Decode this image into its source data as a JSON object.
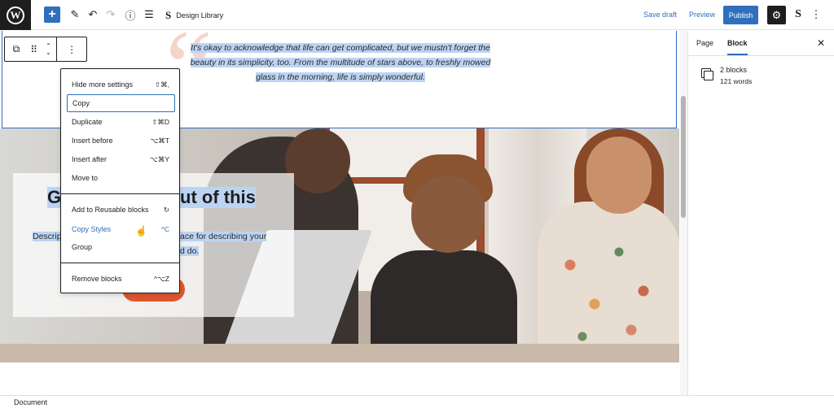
{
  "topbar": {
    "logo_letter": "W",
    "design_library_icon": "S",
    "design_library_label": "Design Library",
    "save_draft": "Save draft",
    "preview": "Preview",
    "publish": "Publish",
    "stackable_icon": "S",
    "icons": [
      "plus-icon",
      "pencil-icon",
      "undo-icon",
      "redo-icon",
      "info-icon",
      "list-view-icon",
      "gear-icon",
      "more-icon"
    ]
  },
  "canvas": {
    "quote_mark": "“",
    "quote_line1": "It's okay to acknowledge that life can get complicated, but we mustn't forget the",
    "quote_line2": "beauty in its simplicity, too. From the multitude of stars above, to freshly mowed",
    "quote_line3": "glass in the morning, life is simply wonderful.",
    "hero_title_left": "G",
    "hero_title_right": "ut of this",
    "hero_desc_left": "Descrip",
    "hero_desc_right": "ace for describing your",
    "hero_desc_line2": "d do."
  },
  "block_menu": {
    "items": [
      {
        "label": "Hide more settings",
        "shortcut": "⇧⌘,"
      },
      {
        "label": "Copy",
        "shortcut": ""
      },
      {
        "label": "Duplicate",
        "shortcut": "⇧⌘D"
      },
      {
        "label": "Insert before",
        "shortcut": "⌥⌘T"
      },
      {
        "label": "Insert after",
        "shortcut": "⌥⌘Y"
      },
      {
        "label": "Move to",
        "shortcut": ""
      },
      {
        "label": "Add to Reusable blocks",
        "shortcut": "↻"
      },
      {
        "label": "Copy Styles",
        "shortcut": "^C"
      },
      {
        "label": "Group",
        "shortcut": ""
      },
      {
        "label": "Remove blocks",
        "shortcut": "^⌥Z"
      }
    ]
  },
  "sidebar": {
    "tabs": [
      "Page",
      "Block"
    ],
    "active_tab": "Block",
    "close": "✕",
    "block_count": "2 blocks",
    "word_count": "121 words"
  },
  "footer": {
    "label": "Document"
  },
  "colors": {
    "accent": "#2f6fbd",
    "selection": "#bcd4f3",
    "hero_button": "#e0552e"
  }
}
